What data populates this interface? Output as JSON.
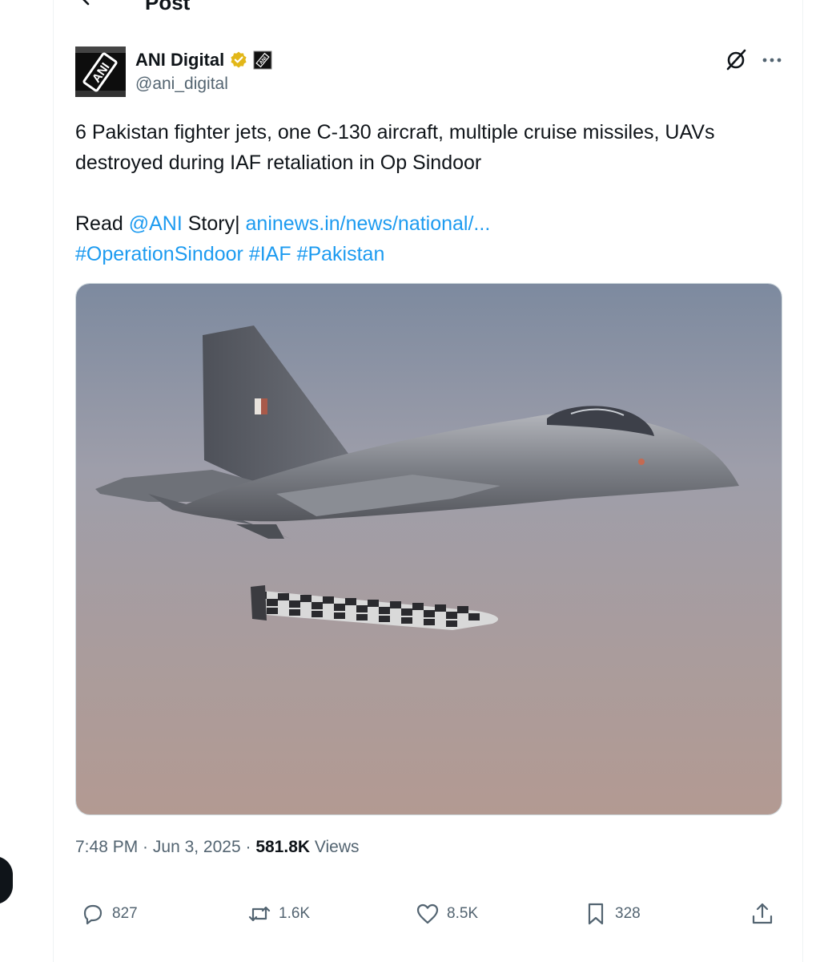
{
  "header": {
    "title": "Post"
  },
  "author": {
    "name": "ANI Digital",
    "handle": "@ani_digital",
    "avatar_text": "ANI",
    "badge_text": "ANI"
  },
  "tweet": {
    "line1": "6 Pakistan fighter jets, one C-130 aircraft, multiple cruise missiles, UAVs",
    "line2": "destroyed during IAF retaliation in Op Sindoor",
    "read_prefix": "Read ",
    "mention": "@ANI",
    "story_text": " Story| ",
    "url": "aninews.in/news/national/...",
    "hashtags": [
      "#OperationSindoor",
      "#IAF",
      "#Pakistan"
    ]
  },
  "meta": {
    "time": "7:48 PM",
    "separator": " · ",
    "date": "Jun 3, 2025",
    "views_count": "581.8K",
    "views_label": " Views"
  },
  "actions": {
    "replies": "827",
    "reposts": "1.6K",
    "likes": "8.5K",
    "bookmarks": "328"
  },
  "colors": {
    "text": "#0f1419",
    "secondary": "#536471",
    "link": "#1d9bf0",
    "verified": "#e2b719",
    "border": "#cfd9de"
  },
  "icons": [
    "back-arrow-icon",
    "verified-badge-icon",
    "affiliate-badge-icon",
    "grok-icon",
    "more-icon",
    "reply-icon",
    "repost-icon",
    "like-icon",
    "bookmark-icon",
    "share-icon"
  ]
}
